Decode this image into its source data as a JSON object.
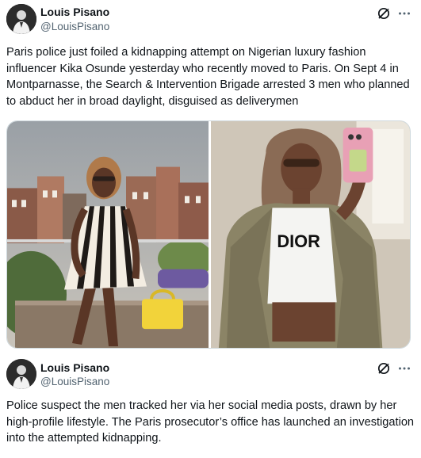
{
  "tweets": [
    {
      "author": {
        "name": "Louis Pisano",
        "handle": "@LouisPisano"
      },
      "text": "Paris police just foiled a kidnapping attempt on Nigerian luxury fashion influencer Kika Osunde yesterday who recently moved to Paris. On Sept 4 in Montparnasse, the Search & Intervention Brigade arrested 3 men who planned to abduct her in broad daylight, disguised as deliverymen",
      "media": [
        {
          "icon": "photo-woman-striped-dress-rooftop"
        },
        {
          "icon": "photo-woman-mirror-selfie"
        }
      ],
      "shirt_text": "DIOR"
    },
    {
      "author": {
        "name": "Louis Pisano",
        "handle": "@LouisPisano"
      },
      "text": "Police suspect the men tracked her via her social media posts, drawn by her high-profile lifestyle. The Paris prosecutor’s office has launched an investigation into the attempted kidnapping."
    }
  ],
  "icons": {
    "grok": "grok-icon",
    "more": "more-dots-icon"
  },
  "colors": {
    "text": "#0f1419",
    "secondary": "#536471",
    "border": "#cfd9de"
  }
}
